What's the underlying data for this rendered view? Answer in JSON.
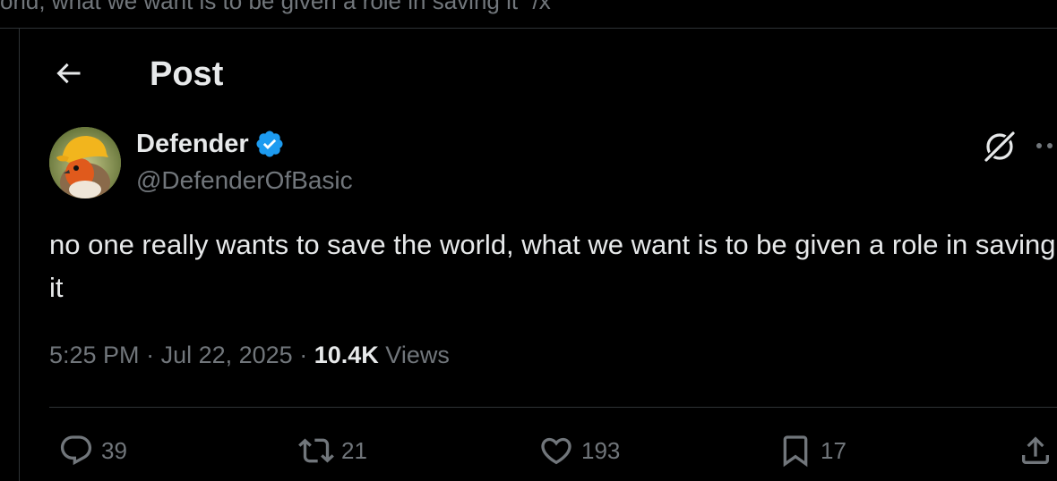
{
  "top_strip": {
    "text": "orld, what we want is to be given a role in saving it\" /x"
  },
  "header": {
    "title": "Post"
  },
  "author": {
    "display_name": "Defender",
    "handle": "@DefenderOfBasic"
  },
  "post": {
    "text": "no one really wants to save the world, what we want is to be given a role in saving it",
    "time": "5:25 PM",
    "date": "Jul 22, 2025",
    "views_count": "10.4K",
    "views_label": "Views"
  },
  "actions": {
    "replies": "39",
    "reposts": "21",
    "likes": "193",
    "bookmarks": "17"
  },
  "colors": {
    "background": "#000000",
    "text": "#e7e9ea",
    "muted": "#71767b",
    "verified": "#1d9bf0",
    "divider": "#2f3336"
  },
  "icons": [
    "back-arrow-icon",
    "verified-badge-icon",
    "grok-icon",
    "more-icon",
    "reply-icon",
    "repost-icon",
    "like-icon",
    "bookmark-icon",
    "share-icon"
  ]
}
